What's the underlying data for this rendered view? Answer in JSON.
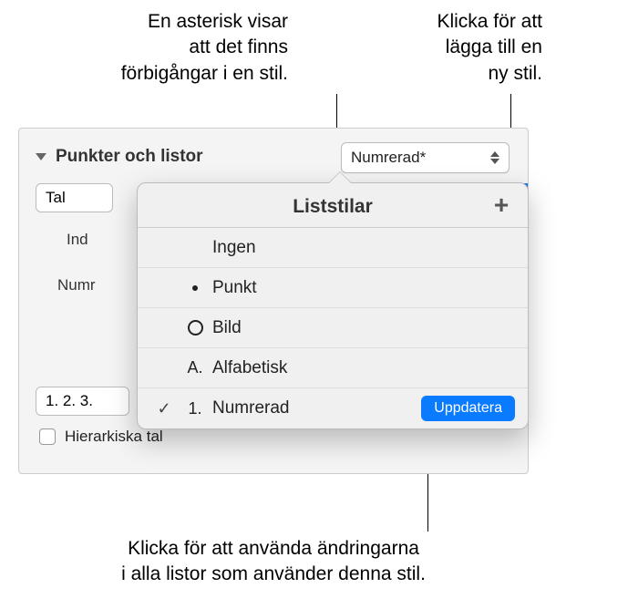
{
  "callouts": {
    "asterisk": "En asterisk visar\natt det finns\nförbigångar i en stil.",
    "add_style": "Klicka för att\nlägga till en\nny stil.",
    "update": "Klicka för att använda ändringarna\ni alla listor som använder denna stil."
  },
  "panel": {
    "section_title": "Punkter och listor",
    "style_dropdown": "Numrerad*",
    "tal_field": "Tal",
    "partial_ind": "Ind",
    "partial_numr": "Numr",
    "seq_field": "1. 2. 3.",
    "checkbox_label": "Hierarkiska tal"
  },
  "popover": {
    "title": "Liststilar",
    "items": [
      {
        "label": "Ingen",
        "glyph": "",
        "checked": false
      },
      {
        "label": "Punkt",
        "glyph": "bullet",
        "checked": false
      },
      {
        "label": "Bild",
        "glyph": "hollow",
        "checked": false
      },
      {
        "label": "Alfabetisk",
        "glyph": "A.",
        "checked": false
      },
      {
        "label": "Numrerad",
        "glyph": "1.",
        "checked": true
      }
    ],
    "update_label": "Uppdatera"
  }
}
